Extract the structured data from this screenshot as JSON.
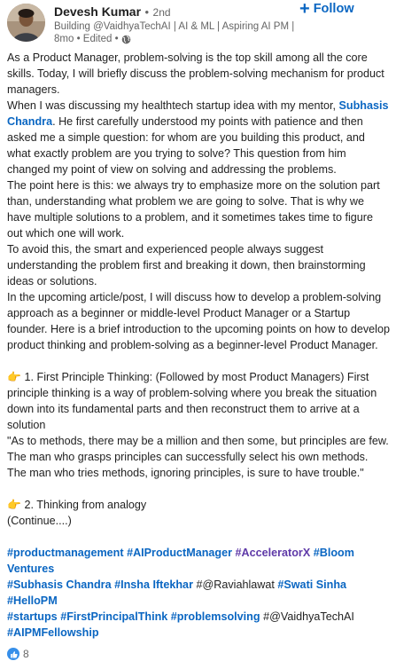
{
  "author": {
    "name": "Devesh Kumar",
    "bullet": "•",
    "degree": "2nd",
    "headline": "Building @VaidhyaTechAI | AI & ML | Aspiring AI PM | ...",
    "meta": "8mo • Edited •"
  },
  "follow_label": "Follow",
  "post": {
    "p1": "As a Product Manager, problem-solving is the top skill among all the core skills. Today, I will briefly discuss the problem-solving mechanism for product managers.",
    "p2_a": "When I was discussing my healthtech startup idea with my mentor, ",
    "p2_mention": "Subhasis Chandra",
    "p2_b": ". He first carefully understood my points with patience and then asked me a simple question: for whom are you building this product, and what exactly problem are you trying to solve? This question from him changed my point of view on solving and addressing the problems.",
    "p3": "The point here is this: we always try to emphasize more on the solution part than, understanding what problem we are going to solve. That is why we have multiple solutions to a problem, and it sometimes takes time to figure out which one will work.",
    "p4": "To avoid this, the smart and experienced people always suggest understanding the problem first and breaking it down, then brainstorming ideas or solutions.",
    "p5": " In the upcoming article/post, I will discuss how to develop a problem-solving approach as a beginner or middle-level Product Manager or a Startup founder. Here is a brief introduction to the upcoming points on how to develop product thinking and problem-solving as a beginner-level Product Manager.",
    "point1_emoji": "👉",
    "point1": " 1. First Principle Thinking: (Followed by most Product Managers) First principle thinking is a way of problem-solving where you break the situation down into its fundamental parts and then reconstruct them to arrive at a solution",
    "quote": " \"As to methods, there may be a million and then some, but principles are few. The man who grasps principles can successfully select his own methods. The man who tries methods, ignoring principles, is sure to have trouble.\"",
    "point2_emoji": "👉",
    "point2": " 2. Thinking from analogy",
    "continue": "(Continue....)"
  },
  "hashtags": {
    "t1": "#productmanagement",
    "t2": "#AIProductManager",
    "t3": "#AcceleratorX",
    "t4": "#Bloom Ventures",
    "t5": "#Subhasis Chandra",
    "t6": "#Insha Iftekhar",
    "t7": "#@Raviahlawat",
    "t8": "#Swati Sinha",
    "t9": "#HelloPM",
    "t10": "#startups",
    "t11": "#FirstPrincipalThink",
    "t12": "#problemsolving",
    "t13": "#@VaidhyaTechAI",
    "t14": "#AIPMFellowship"
  },
  "reactions": {
    "count": "8"
  },
  "colors": {
    "link": "#0a66c2",
    "accent_purple": "#5f3aa8",
    "like": "#378fe9"
  },
  "icons": {
    "follow": "plus-icon",
    "visibility": "globe-icon",
    "reaction": "like-icon"
  }
}
